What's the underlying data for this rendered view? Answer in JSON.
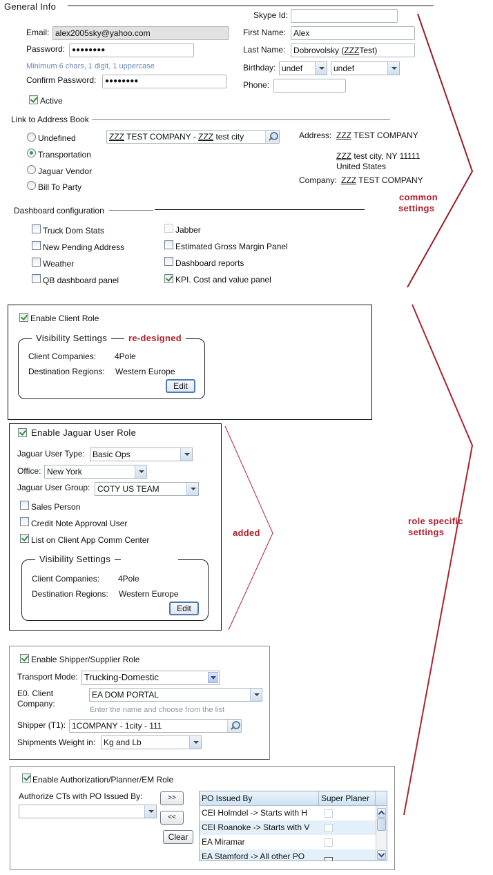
{
  "general_info": {
    "title": "General Info",
    "email_label": "Email:",
    "email_value": "alex2005sky@yahoo.com",
    "password_label": "Password:",
    "password_value": "●●●●●●●●",
    "password_hint": "Minimum 6 chars, 1 digit, 1 uppercase",
    "confirm_password_label": "Confirm Password:",
    "confirm_password_value": "●●●●●●●●",
    "active_label": "Active",
    "active_checked": true,
    "skype_label": "Skype Id:",
    "skype_value": "",
    "first_name_label": "First Name:",
    "first_name_value": "Alex",
    "last_name_label": "Last Name:",
    "last_name_prefix": "Dobrovolsky (",
    "last_name_zzz": "ZZZ",
    "last_name_suffix": "Test)",
    "birthday_label": "Birthday:",
    "birthday_month": "undef",
    "birthday_day": "undef",
    "phone_label": "Phone:",
    "phone_value": ""
  },
  "address_book": {
    "title": "Link to Address Book",
    "radio_options": [
      {
        "label": "Undefined",
        "checked": false
      },
      {
        "label": "Transportation",
        "checked": true
      },
      {
        "label": "Jaguar Vendor",
        "checked": false
      },
      {
        "label": "Bill To Party",
        "checked": false
      }
    ],
    "lookup_zzz1": "ZZZ",
    "lookup_mid": " TEST COMPANY - ",
    "lookup_zzz2": "ZZZ",
    "lookup_end": " test city",
    "address_label": "Address:",
    "address_zzz": "ZZZ",
    "address_line1": " TEST COMPANY",
    "address_city_zzz": "ZZZ",
    "address_line2": " test city, NY 11111",
    "address_line3": "United States",
    "company_label": "Company:",
    "company_zzz": "ZZZ",
    "company_value": " TEST COMPANY"
  },
  "dashboard": {
    "title": "Dashboard configuration",
    "left_items": [
      {
        "label": "Truck Dom Stats",
        "checked": false
      },
      {
        "label": "New Pending Address",
        "checked": false
      },
      {
        "label": "Weather",
        "checked": false
      },
      {
        "label": "QB dashboard panel",
        "checked": false
      }
    ],
    "right_items": [
      {
        "label": "Jabber",
        "checked": false,
        "disabled": true
      },
      {
        "label": "Estimated Gross Margin Panel",
        "checked": false
      },
      {
        "label": "Dashboard reports",
        "checked": false
      },
      {
        "label": "KPI. Cost and value panel",
        "checked": true
      }
    ]
  },
  "annotations": {
    "common_line1": "common",
    "common_line2": "settings",
    "redesigned": "re-designed",
    "added": "added",
    "role_line1": "role specific",
    "role_line2": "settings",
    "color": "#b0202c"
  },
  "client_role": {
    "enable_label": "Enable Client Role",
    "enabled": true,
    "visibility_title": "Visibility Settings",
    "client_companies_label": "Client Companies:",
    "client_companies_value": "4Pole",
    "destination_regions_label": "Destination Regions:",
    "destination_regions_value": "Western Europe",
    "edit_label": "Edit"
  },
  "jaguar_role": {
    "enable_label": "Enable Jaguar User Role",
    "enabled": true,
    "user_type_label": "Jaguar User Type:",
    "user_type_value": "Basic Ops",
    "office_label": "Office:",
    "office_value": "New York",
    "user_group_label": "Jaguar User Group:",
    "user_group_value": "COTY US TEAM",
    "checkboxes": [
      {
        "label": "Sales Person",
        "checked": false
      },
      {
        "label": "Credit Note Approval User",
        "checked": false
      },
      {
        "label": "List on Client App Comm Center",
        "checked": true
      }
    ],
    "visibility_title": "Visibility Settings",
    "client_companies_label": "Client Companies:",
    "client_companies_value": "4Pole",
    "destination_regions_label": "Destination Regions:",
    "destination_regions_value": "Western Europe",
    "edit_label": "Edit"
  },
  "shipper_role": {
    "enable_label": "Enable Shipper/Supplier Role",
    "enabled": true,
    "transport_mode_label": "Transport Mode:",
    "transport_mode_value": "Trucking-Domestic",
    "client_company_label_1": "E0. Client",
    "client_company_label_2": "Company:",
    "client_company_value": "EA DOM PORTAL",
    "client_company_hint": "Enter the name and choose from the list",
    "shipper_label": "Shipper (T1):",
    "shipper_value": "1COMPANY - 1city - 111",
    "weight_label": "Shipments Weight in:",
    "weight_value": "Kg and Lb"
  },
  "authorization_role": {
    "enable_label": "Enable Authorization/Planner/EM Role",
    "enabled": true,
    "authorize_label": "Authorize CTs with PO Issued By:",
    "authorize_value": "",
    "add_button": ">>",
    "remove_button": "<<",
    "clear_button": "Clear",
    "table_headers": [
      "PO Issued By",
      "Super Planer"
    ],
    "table_rows": [
      {
        "po": "CEI Holmdel -> Starts with H",
        "super": false
      },
      {
        "po": "CEI Roanoke -> Starts with V",
        "super": false
      },
      {
        "po": "EA Miramar",
        "super": false
      },
      {
        "po": "EA Stamford -> All other PO",
        "super": false
      }
    ]
  }
}
